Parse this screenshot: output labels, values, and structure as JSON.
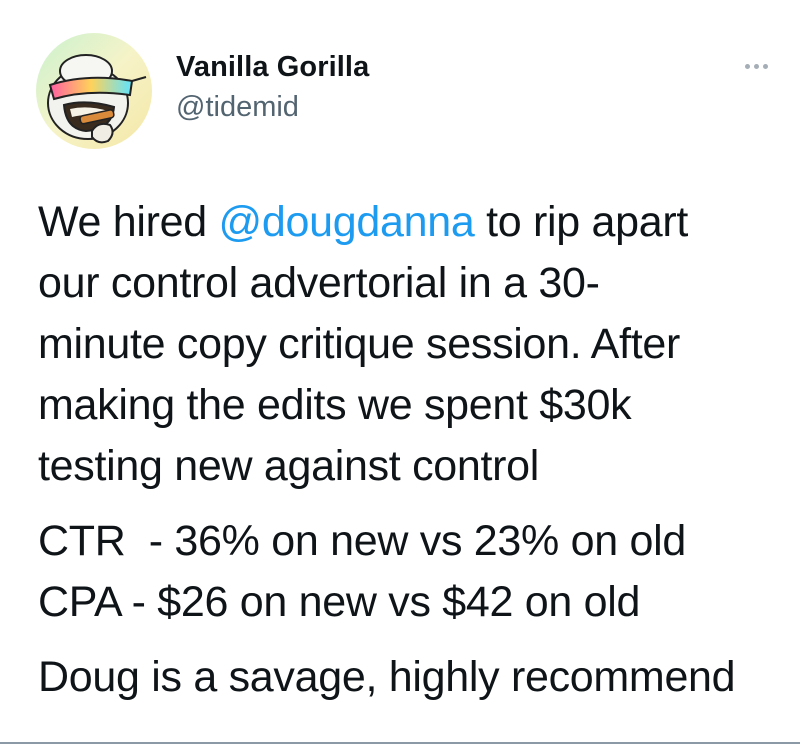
{
  "author": {
    "display_name": "Vanilla Gorilla",
    "handle": "@tidemid"
  },
  "menu_icon": "more-horizontal-icon",
  "tweet": {
    "line1_pre": "We hired ",
    "mention": "@dougdanna",
    "line1_post": " to rip apart",
    "line2": "our control advertorial in a 30-",
    "line3": "minute copy critique session. After",
    "line4": "making the edits we spent $30k",
    "line5": "testing new against control",
    "stat_ctr": "CTR  - 36% on new vs 23% on old",
    "stat_cpa": "CPA - $26 on new vs $42 on old",
    "closing": "Doug is a savage, highly recommend"
  },
  "colors": {
    "mention": "#1d9bf0",
    "secondary_text": "#536471",
    "primary_text": "#0f1419"
  }
}
